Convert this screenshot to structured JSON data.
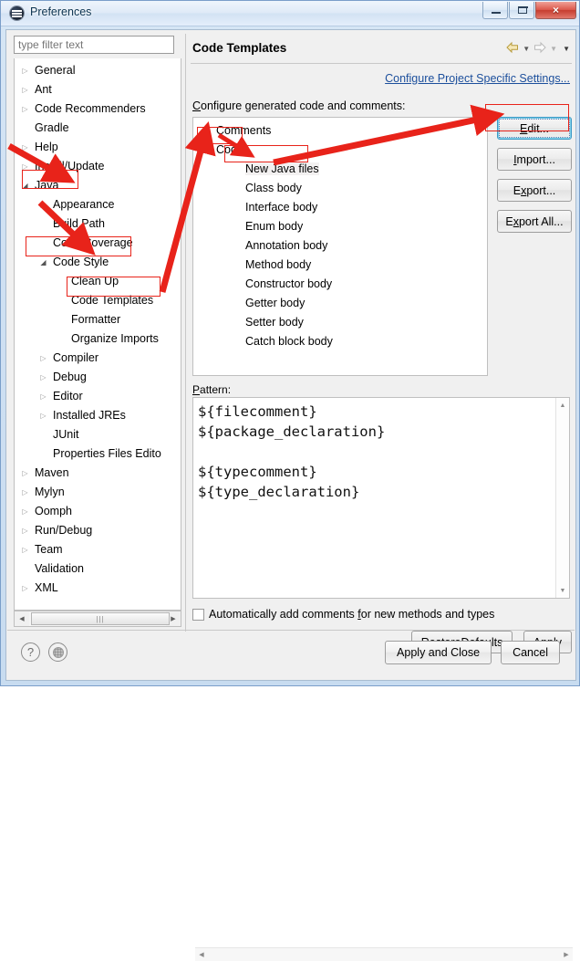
{
  "window": {
    "title": "Preferences",
    "icon": "eclipse-icon",
    "controls": {
      "minimize": "minimize-icon",
      "maximize": "maximize-icon",
      "close": "×"
    }
  },
  "sidebar": {
    "filter_placeholder": "type filter text",
    "filter_value": "",
    "items": [
      {
        "label": "General",
        "indent": 0,
        "twisty": "collapsed"
      },
      {
        "label": "Ant",
        "indent": 0,
        "twisty": "collapsed"
      },
      {
        "label": "Code Recommenders",
        "indent": 0,
        "twisty": "collapsed"
      },
      {
        "label": "Gradle",
        "indent": 0,
        "twisty": "none"
      },
      {
        "label": "Help",
        "indent": 0,
        "twisty": "collapsed"
      },
      {
        "label": "Install/Update",
        "indent": 0,
        "twisty": "collapsed"
      },
      {
        "label": "Java",
        "indent": 0,
        "twisty": "expanded"
      },
      {
        "label": "Appearance",
        "indent": 1,
        "twisty": "collapsed"
      },
      {
        "label": "Build Path",
        "indent": 1,
        "twisty": "none"
      },
      {
        "label": "Code Coverage",
        "indent": 1,
        "twisty": "none"
      },
      {
        "label": "Code Style",
        "indent": 1,
        "twisty": "expanded"
      },
      {
        "label": "Clean Up",
        "indent": 2,
        "twisty": "none"
      },
      {
        "label": "Code Templates",
        "indent": 2,
        "twisty": "none"
      },
      {
        "label": "Formatter",
        "indent": 2,
        "twisty": "none"
      },
      {
        "label": "Organize Imports",
        "indent": 2,
        "twisty": "none"
      },
      {
        "label": "Compiler",
        "indent": 1,
        "twisty": "collapsed"
      },
      {
        "label": "Debug",
        "indent": 1,
        "twisty": "collapsed"
      },
      {
        "label": "Editor",
        "indent": 1,
        "twisty": "collapsed"
      },
      {
        "label": "Installed JREs",
        "indent": 1,
        "twisty": "collapsed"
      },
      {
        "label": "JUnit",
        "indent": 1,
        "twisty": "none"
      },
      {
        "label": "Properties Files Edito",
        "indent": 1,
        "twisty": "none"
      },
      {
        "label": "Maven",
        "indent": 0,
        "twisty": "collapsed"
      },
      {
        "label": "Mylyn",
        "indent": 0,
        "twisty": "collapsed"
      },
      {
        "label": "Oomph",
        "indent": 0,
        "twisty": "collapsed"
      },
      {
        "label": "Run/Debug",
        "indent": 0,
        "twisty": "collapsed"
      },
      {
        "label": "Team",
        "indent": 0,
        "twisty": "collapsed"
      },
      {
        "label": "Validation",
        "indent": 0,
        "twisty": "none"
      },
      {
        "label": "XML",
        "indent": 0,
        "twisty": "collapsed"
      }
    ]
  },
  "pane": {
    "title": "Code Templates",
    "nav": {
      "back": "back-arrow-icon",
      "back_menu": "chevron-down-icon",
      "forward": "forward-arrow-icon",
      "forward_menu": "chevron-down-icon",
      "view_menu": "chevron-down-icon"
    },
    "configure_link": "Configure Project Specific Settings...",
    "group_label": "Configure generated code and comments:",
    "templates": [
      {
        "label": "Comments",
        "indent": 0,
        "twisty": "collapsed",
        "selected": false
      },
      {
        "label": "Code",
        "indent": 0,
        "twisty": "expanded",
        "selected": false
      },
      {
        "label": "New Java files",
        "indent": 1,
        "twisty": "none",
        "selected": true
      },
      {
        "label": "Class body",
        "indent": 1,
        "twisty": "none",
        "selected": false
      },
      {
        "label": "Interface body",
        "indent": 1,
        "twisty": "none",
        "selected": false
      },
      {
        "label": "Enum body",
        "indent": 1,
        "twisty": "none",
        "selected": false
      },
      {
        "label": "Annotation body",
        "indent": 1,
        "twisty": "none",
        "selected": false
      },
      {
        "label": "Method body",
        "indent": 1,
        "twisty": "none",
        "selected": false
      },
      {
        "label": "Constructor body",
        "indent": 1,
        "twisty": "none",
        "selected": false
      },
      {
        "label": "Getter body",
        "indent": 1,
        "twisty": "none",
        "selected": false
      },
      {
        "label": "Setter body",
        "indent": 1,
        "twisty": "none",
        "selected": false
      },
      {
        "label": "Catch block body",
        "indent": 1,
        "twisty": "none",
        "selected": false
      }
    ],
    "buttons": {
      "edit": "Edit...",
      "import": "Import...",
      "export": "Export...",
      "export_all": "Export All..."
    },
    "pattern_label": "Pattern:",
    "pattern_value": "${filecomment}\n${package_declaration}\n\n${typecomment}\n${type_declaration}",
    "auto_comments_label": "Automatically add comments for new methods and types",
    "auto_comments_checked": false,
    "restore_defaults": "Restore Defaults",
    "apply": "Apply"
  },
  "footer": {
    "help_icon": "?",
    "details_icon": "details-icon",
    "apply_and_close": "Apply and Close",
    "cancel": "Cancel"
  },
  "annotations": {
    "color": "#e8231a",
    "highlights": [
      "Java",
      "Code Style",
      "Code Templates",
      "Code",
      "New Java files",
      "Edit..."
    ]
  }
}
